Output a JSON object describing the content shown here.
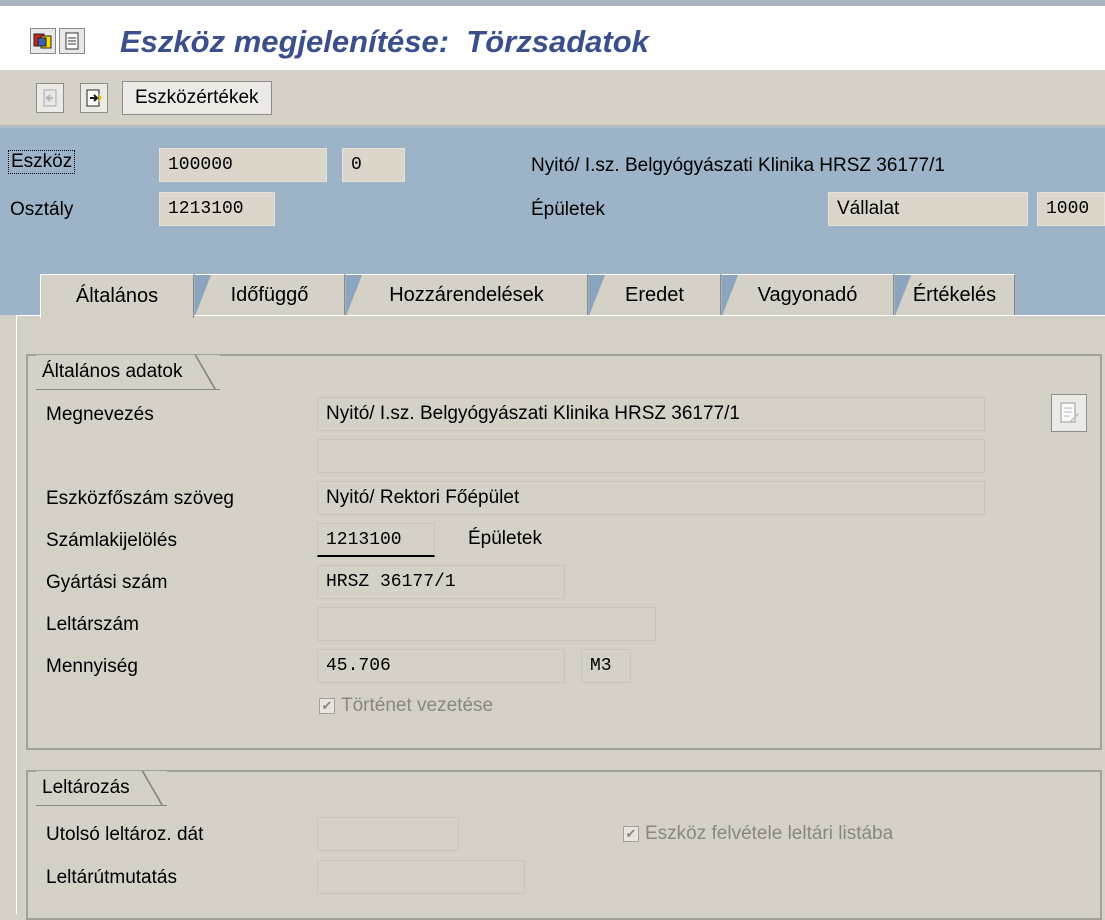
{
  "title": "Eszköz megjelenítése:  Törzsadatok",
  "toolbar": {
    "values_button": "Eszközértékek"
  },
  "header": {
    "asset_label": "Eszköz",
    "asset_number": "100000",
    "asset_sub": "0",
    "asset_desc": "Nyitó/ I.sz. Belgyógyászati Klinika HRSZ 36177/1",
    "class_label": "Osztály",
    "class_value": "1213100",
    "class_desc": "Épületek",
    "company_label": "Vállalat",
    "company_value": "1000"
  },
  "tabs": [
    {
      "label": "Általános"
    },
    {
      "label": "Időfüggő"
    },
    {
      "label": "Hozzárendelések"
    },
    {
      "label": "Eredet"
    },
    {
      "label": "Vagyonadó"
    },
    {
      "label": "Értékelés"
    }
  ],
  "general": {
    "title": "Általános adatok",
    "name_label": "Megnevezés",
    "name_value": "Nyitó/ I.sz. Belgyógyászati Klinika HRSZ 36177/1",
    "name_value2": "",
    "main_text_label": "Eszközfőszám szöveg",
    "main_text_value": "Nyitó/ Rektori Főépület",
    "acct_label": "Számlakijelölés",
    "acct_value": "1213100",
    "acct_desc": "Épületek",
    "serial_label": "Gyártási szám",
    "serial_value": "HRSZ 36177/1",
    "inventory_label": "Leltárszám",
    "inventory_value": "",
    "qty_label": "Mennyiség",
    "qty_value": "45.706",
    "qty_unit": "M3",
    "history_label": "Történet vezetése"
  },
  "inventory": {
    "title": "Leltározás",
    "last_date_label": "Utolsó leltároz. dát",
    "last_date_value": "",
    "note_label": "Leltárútmutatás",
    "note_value": "",
    "include_label": "Eszköz felvétele leltári listába"
  }
}
